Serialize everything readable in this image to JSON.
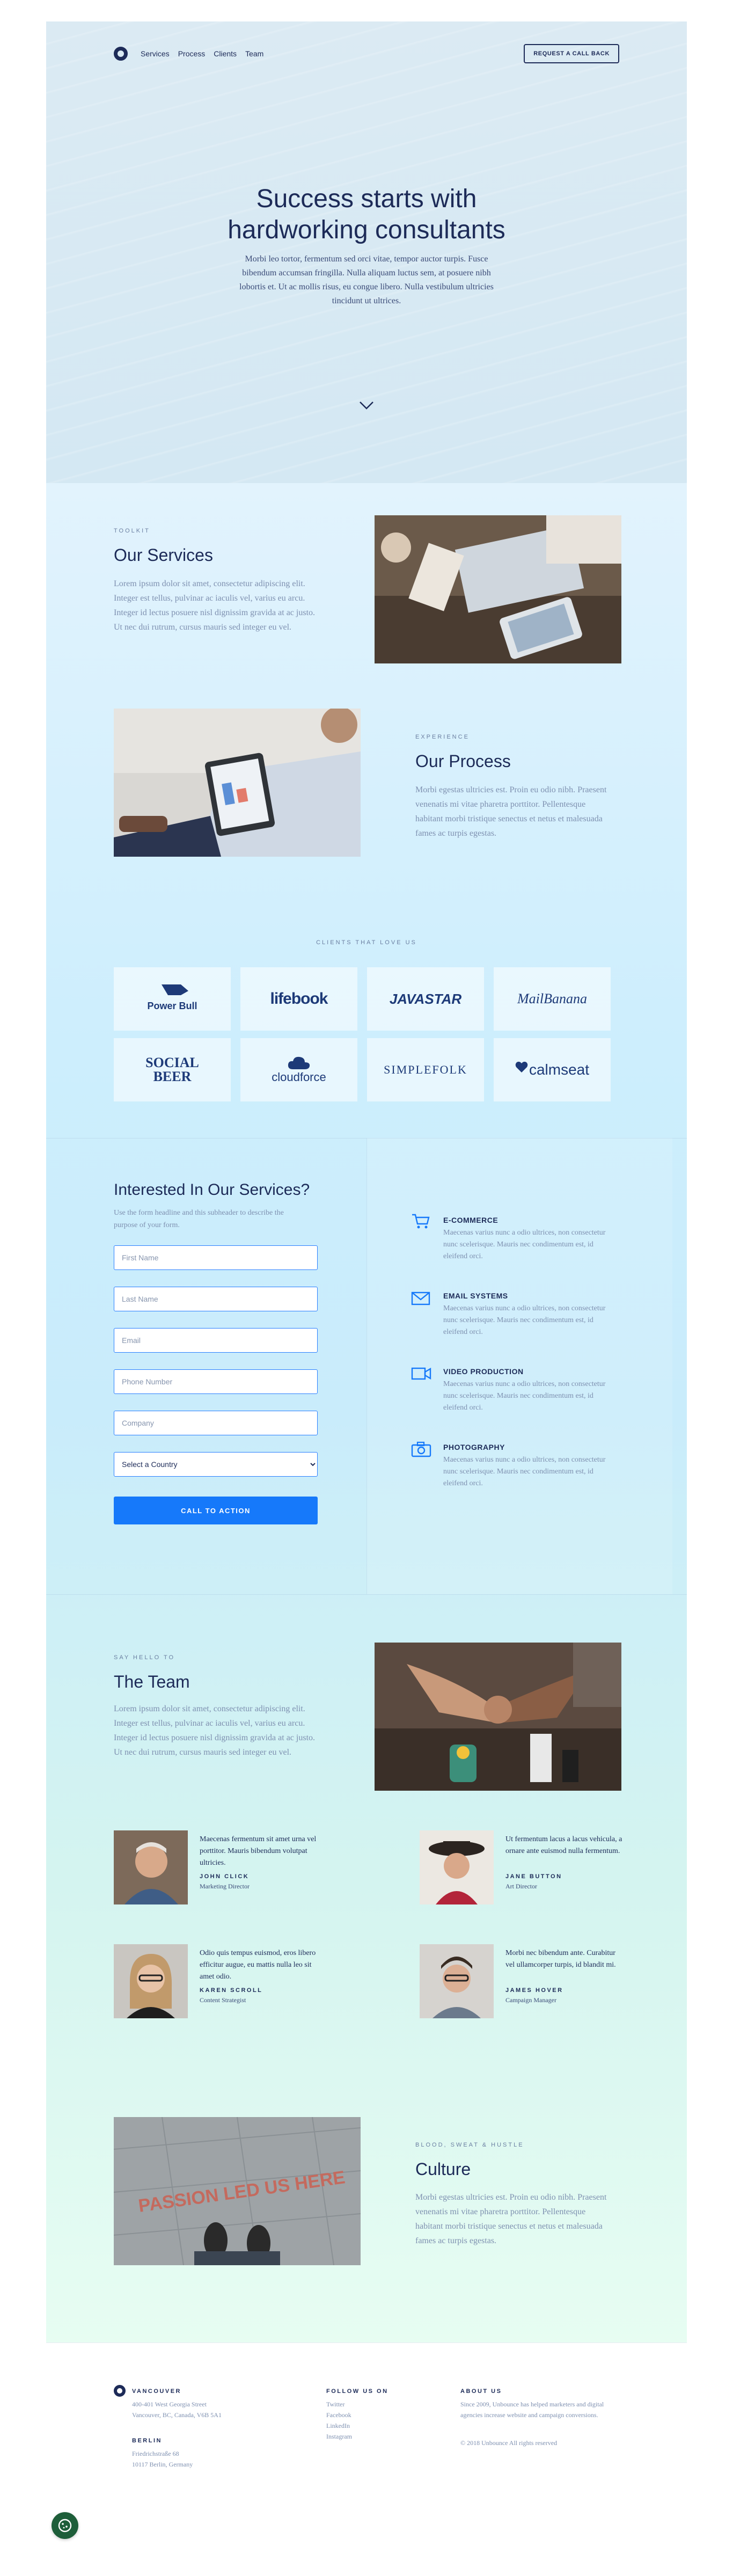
{
  "nav": {
    "links": [
      "Services",
      "Process",
      "Clients",
      "Team"
    ],
    "cta_label": "REQUEST A CALL BACK"
  },
  "hero": {
    "title": "Success starts with hardworking consultants",
    "text": "Morbi leo tortor, fermentum sed orci vitae, tempor auctor turpis. Fusce bibendum accumsan fringilla. Nulla aliquam luctus sem, at posuere nibh lobortis et. Ut ac mollis risus, eu congue libero. Nulla vestibulum ultricies tincidunt ut ultrices."
  },
  "services": {
    "eyebrow": "TOOLKIT",
    "title": "Our Services",
    "text": "Lorem ipsum dolor sit amet, consectetur adipiscing elit. Integer est tellus, pulvinar ac iaculis vel, varius eu arcu. Integer id lectus posuere nisl dignissim gravida at ac justo. Ut nec dui rutrum, cursus mauris sed integer eu vel."
  },
  "process": {
    "eyebrow": "EXPERIENCE",
    "title": "Our Process",
    "text": "Morbi egestas ultricies est. Proin eu odio nibh. Praesent venenatis mi vitae pharetra porttitor. Pellentesque habitant morbi tristique senectus et netus et malesuada fames ac turpis egestas."
  },
  "clients": {
    "eyebrow": "CLIENTS THAT LOVE US",
    "logos": [
      "Power Bull",
      "lifebook",
      "JAVASTAR",
      "MailBanana",
      "SOCIAL BEER",
      "cloudforce",
      "SIMPLEFOLK",
      "calmseat"
    ]
  },
  "contact": {
    "title": "Interested In Our Services?",
    "subtitle": "Use the form headline and this subheader to describe the purpose of your form.",
    "placeholders": {
      "first_name": "First Name",
      "last_name": "Last Name",
      "email": "Email",
      "phone": "Phone Number",
      "company": "Company"
    },
    "country_selected": "Select a Country",
    "submit_label": "CALL TO ACTION",
    "services": [
      {
        "title": "E-COMMERCE",
        "text": "Maecenas varius nunc a odio ultrices, non consectetur nunc scelerisque. Mauris nec condimentum est, id eleifend orci."
      },
      {
        "title": "EMAIL SYSTEMS",
        "text": "Maecenas varius nunc a odio ultrices, non consectetur nunc scelerisque. Mauris nec condimentum est, id eleifend orci."
      },
      {
        "title": "VIDEO PRODUCTION",
        "text": "Maecenas varius nunc a odio ultrices, non consectetur nunc scelerisque. Mauris nec condimentum est, id eleifend orci."
      },
      {
        "title": "PHOTOGRAPHY",
        "text": "Maecenas varius nunc a odio ultrices, non consectetur nunc scelerisque. Mauris nec condimentum est, id eleifend orci."
      }
    ]
  },
  "team": {
    "eyebrow": "SAY HELLO TO",
    "title": "The Team",
    "text": "Lorem ipsum dolor sit amet, consectetur adipiscing elit. Integer est tellus, pulvinar ac iaculis vel, varius eu arcu. Integer id lectus posuere nisl dignissim gravida at ac justo. Ut nec dui rutrum, cursus mauris sed integer eu vel.",
    "members": [
      {
        "quote": "Maecenas fermentum sit amet urna vel porttitor. Mauris bibendum volutpat ultricies.",
        "name": "JOHN CLICK",
        "role": "Marketing Director"
      },
      {
        "quote": "Ut fermentum lacus a lacus vehicula, a ornare ante euismod nulla fermentum.",
        "name": "JANE BUTTON",
        "role": "Art Director"
      },
      {
        "quote": "Odio quis tempus euismod, eros libero efficitur augue, eu mattis nulla leo sit amet odio.",
        "name": "KAREN SCROLL",
        "role": "Content Strategist"
      },
      {
        "quote": "Morbi nec bibendum ante. Curabitur vel ullamcorper turpis, id blandit mi.",
        "name": "JAMES HOVER",
        "role": "Campaign Manager"
      }
    ]
  },
  "culture": {
    "eyebrow": "BLOOD, SWEAT & HUSTLE",
    "title": "Culture",
    "text": "Morbi egestas ultricies est. Proin eu odio nibh. Praesent venenatis mi vitae pharetra porttitor. Pellentesque habitant morbi tristique senectus et netus et malesuada fames ac turpis egestas.",
    "photo_caption": "PASSION LED US HERE"
  },
  "footer": {
    "vancouver_title": "VANCOUVER",
    "vancouver_address": [
      "400-401 West Georgia Street",
      "Vancouver, BC, Canada, V6B 5A1"
    ],
    "berlin_title": "BERLIN",
    "berlin_address": [
      "Friedrichstraße 68",
      "10117 Berlin, Germany"
    ],
    "follow_title": "FOLLOW US ON",
    "social": [
      "Twitter",
      "Facebook",
      "LinkedIn",
      "Instagram"
    ],
    "about_title": "ABOUT US",
    "about_text": "Since 2009, Unbounce has helped marketers and digital agencies increase website and campaign conversions.",
    "copyright": "© 2018 Unbounce All rights reserved"
  },
  "colors": {
    "navy": "#1d2b58",
    "accent_blue": "#1679fa",
    "muted_text": "#7e90b0"
  }
}
